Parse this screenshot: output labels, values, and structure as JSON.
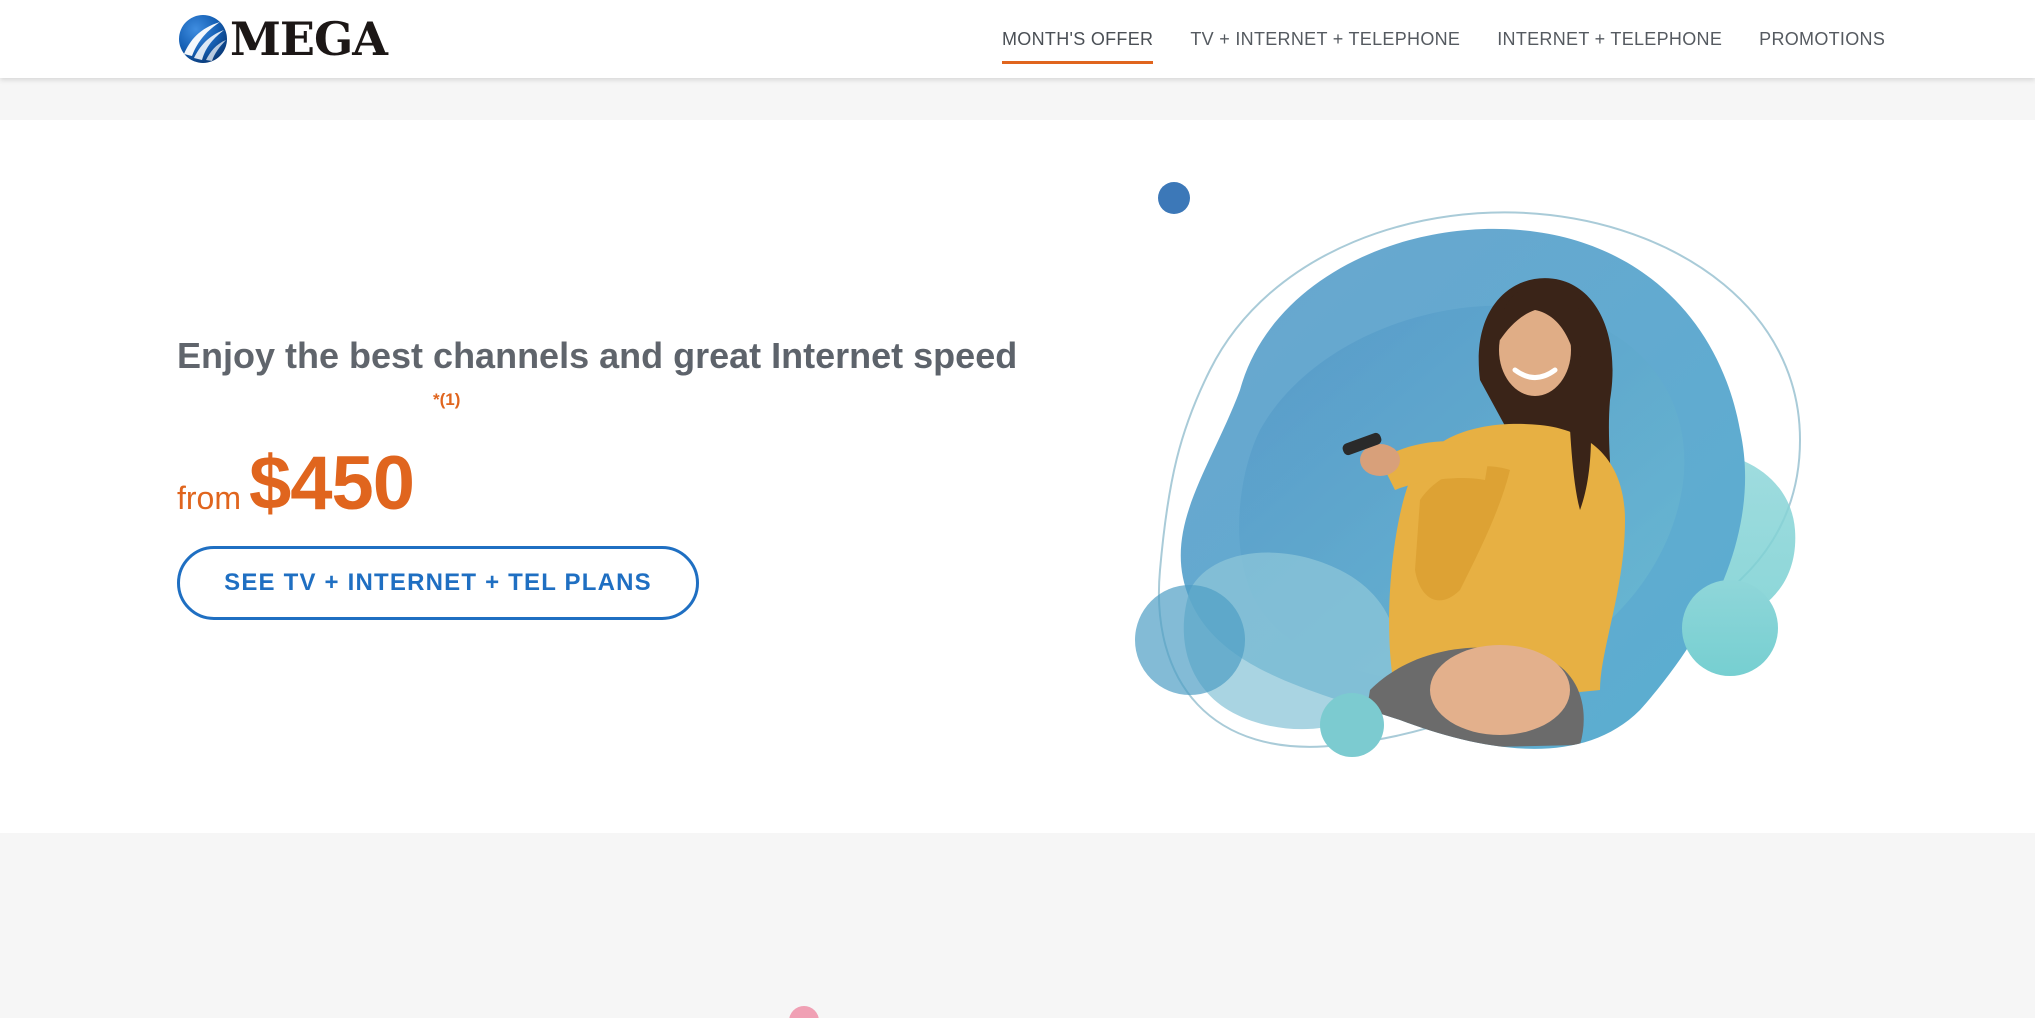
{
  "header": {
    "logo_text": "MEGA",
    "nav": [
      {
        "label": "MONTH'S OFFER",
        "active": true
      },
      {
        "label": "TV + INTERNET + TELEPHONE",
        "active": false
      },
      {
        "label": "INTERNET + TELEPHONE",
        "active": false
      },
      {
        "label": "PROMOTIONS",
        "active": false
      }
    ]
  },
  "hero": {
    "headline_regular": "Enjoy the best channels and ",
    "headline_bold": "great Internet speed",
    "footnote": "*(1)",
    "price_prefix": "from",
    "price": "$450",
    "cta_label": "SEE TV + INTERNET + TEL PLANS",
    "image_icon": "woman-with-remote-illustration"
  },
  "colors": {
    "accent_orange": "#e0651e",
    "brand_blue": "#1f6fc2",
    "text_gray": "#60656c",
    "page_bg": "#f6f6f6"
  }
}
